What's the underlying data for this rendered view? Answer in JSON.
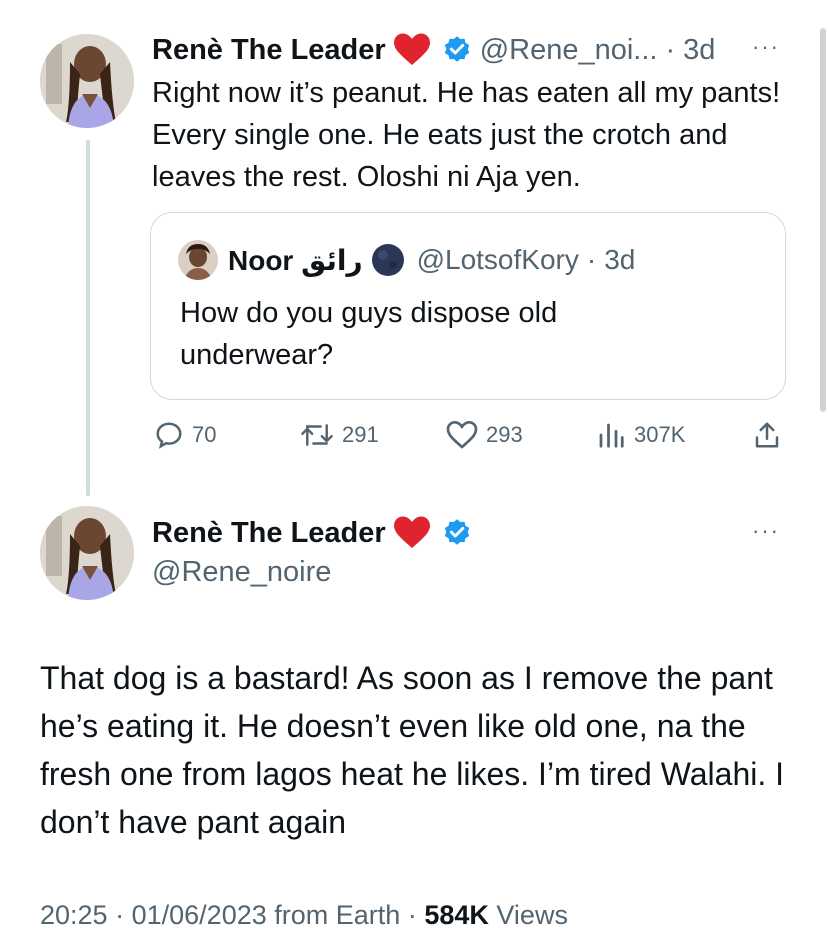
{
  "tweet": {
    "name": "Renè The Leader",
    "handle": "@Rene_noi...",
    "sep": "·",
    "time": "3d",
    "more": "···",
    "text": "Right now it’s peanut. He has eaten all my pants! Every single one. He eats just the crotch and leaves the rest. Oloshi ni Aja yen."
  },
  "quote": {
    "name": "Noor رائق",
    "handle": "@LotsofKory",
    "sep": "·",
    "time": "3d",
    "text": "How do you guys dispose old underwear?"
  },
  "actions": {
    "replies": "70",
    "retweets": "291",
    "likes": "293",
    "views": "307K"
  },
  "reply": {
    "name": "Renè The Leader",
    "handle": "@Rene_noire",
    "more": "···",
    "text": "That dog is a bastard! As soon as I remove the pant he’s eating it. He doesn’t even like old one, na the fresh one from lagos heat he likes. I’m tired Walahi. I don’t have pant again"
  },
  "footer": {
    "time": "20:25",
    "sep1": "·",
    "date": "01/06/2023",
    "source": "from Earth",
    "sep2": "·",
    "views_count": "584K",
    "views_label": "Views"
  },
  "icons": {
    "heart_emoji": "red-heart-icon",
    "verified": "verified-badge-icon",
    "reply": "reply-icon",
    "retweet": "retweet-icon",
    "like": "like-icon",
    "views": "views-icon",
    "share": "share-icon"
  },
  "colors": {
    "verified": "#1d9bf0",
    "heart": "#e0242f",
    "text": "#0f1419",
    "muted": "#536471",
    "border": "#cfd9de"
  }
}
